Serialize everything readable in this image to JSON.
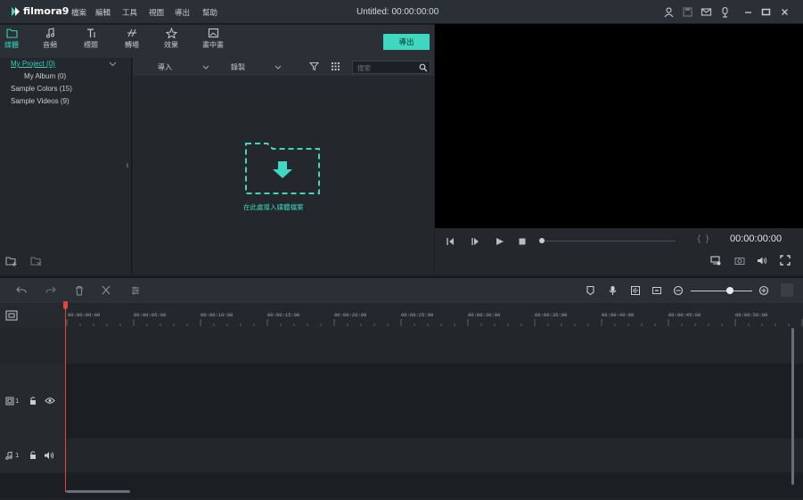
{
  "app": {
    "logo_text": "filmora9",
    "window_title": "Untitled: 00:00:00:00"
  },
  "menu": [
    {
      "label": "檔案"
    },
    {
      "label": "編輯"
    },
    {
      "label": "工具"
    },
    {
      "label": "視圖"
    },
    {
      "label": "導出"
    },
    {
      "label": "幫助"
    }
  ],
  "categories": [
    {
      "label": "媒體",
      "icon": "folder-icon",
      "active": true
    },
    {
      "label": "音頻",
      "icon": "music-note-icon"
    },
    {
      "label": "標題",
      "icon": "title-text-icon"
    },
    {
      "label": "轉場",
      "icon": "transition-icon"
    },
    {
      "label": "效果",
      "icon": "effects-icon"
    },
    {
      "label": "畫中畫",
      "icon": "picture-in-picture-icon"
    }
  ],
  "export_label": "導出",
  "tree": {
    "items": [
      {
        "label": "My Project (0)"
      },
      {
        "label": "My Album (0)"
      },
      {
        "label": "Sample Colors (15)"
      },
      {
        "label": "Sample Videos (9)"
      }
    ]
  },
  "media_bar": {
    "import_label": "導入",
    "record_label": "錄製",
    "search_placeholder": "搜索"
  },
  "drop_zone": {
    "label": "在此處導入媒體檔案"
  },
  "player": {
    "timecode": "00:00:00:00",
    "marks": "{ }"
  },
  "ruler": {
    "ticks": [
      "00:00:00:00",
      "00:00:05:00",
      "00:00:10:00",
      "00:00:15:00",
      "00:00:20:00",
      "00:00:25:00",
      "00:00:30:00",
      "00:00:35:00",
      "00:00:40:00",
      "00:00:45:00",
      "00:00:50:00"
    ]
  },
  "tracks": {
    "video_label": "1",
    "audio_label": "1"
  },
  "colors": {
    "accent": "#3fd7bf",
    "playhead": "#e0463c",
    "background": "#1e2226"
  }
}
